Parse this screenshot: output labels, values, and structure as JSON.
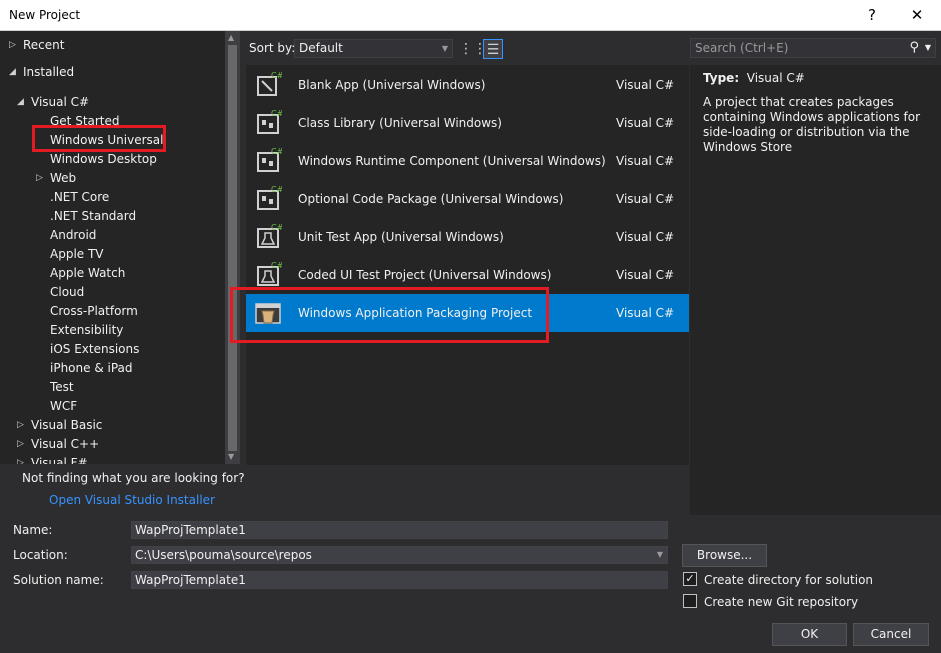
{
  "window": {
    "title": "New Project",
    "help_glyph": "?",
    "close_glyph": "✕"
  },
  "tree": {
    "recent": "Recent",
    "installed": "Installed",
    "visual_csharp": "Visual C#",
    "children": [
      "Get Started",
      "Windows Universal",
      "Windows Desktop",
      "Web",
      ".NET Core",
      ".NET Standard",
      "Android",
      "Apple TV",
      "Apple Watch",
      "Cloud",
      "Cross-Platform",
      "Extensibility",
      "iOS Extensions",
      "iPhone & iPad",
      "Test",
      "WCF"
    ],
    "visual_basic": "Visual Basic",
    "visual_cpp": "Visual C++",
    "visual_fsharp": "Visual F#",
    "selected": "Windows Universal"
  },
  "not_found": {
    "text": "Not finding what you are looking for?",
    "link": "Open Visual Studio Installer"
  },
  "sort": {
    "label": "Sort by:",
    "value": "Default"
  },
  "templates": [
    {
      "name": "Blank App (Universal Windows)",
      "lang": "Visual C#"
    },
    {
      "name": "Class Library (Universal Windows)",
      "lang": "Visual C#"
    },
    {
      "name": "Windows Runtime Component (Universal Windows)",
      "lang": "Visual C#"
    },
    {
      "name": "Optional Code Package (Universal Windows)",
      "lang": "Visual C#"
    },
    {
      "name": "Unit Test App (Universal Windows)",
      "lang": "Visual C#"
    },
    {
      "name": "Coded UI Test Project (Universal Windows)",
      "lang": "Visual C#"
    },
    {
      "name": "Windows Application Packaging Project",
      "lang": "Visual C#"
    }
  ],
  "selected_template": "Windows Application Packaging Project",
  "search": {
    "placeholder": "Search (Ctrl+E)"
  },
  "details": {
    "type_label": "Type:",
    "type_value": "Visual C#",
    "description": "A project that creates packages containing Windows applications for side-loading or distribution via the Windows Store"
  },
  "form": {
    "name_label": "Name:",
    "name_value": "WapProjTemplate1",
    "location_label": "Location:",
    "location_value": "C:\\Users\\pouma\\source\\repos",
    "solution_label": "Solution name:",
    "solution_value": "WapProjTemplate1",
    "browse": "Browse...",
    "create_dir_label": "Create directory for solution",
    "create_dir_checked": true,
    "git_label": "Create new Git repository",
    "git_checked": false,
    "ok": "OK",
    "cancel": "Cancel"
  },
  "colors": {
    "selection": "#007acc",
    "highlight": "#e31b23",
    "link": "#3794ff"
  }
}
